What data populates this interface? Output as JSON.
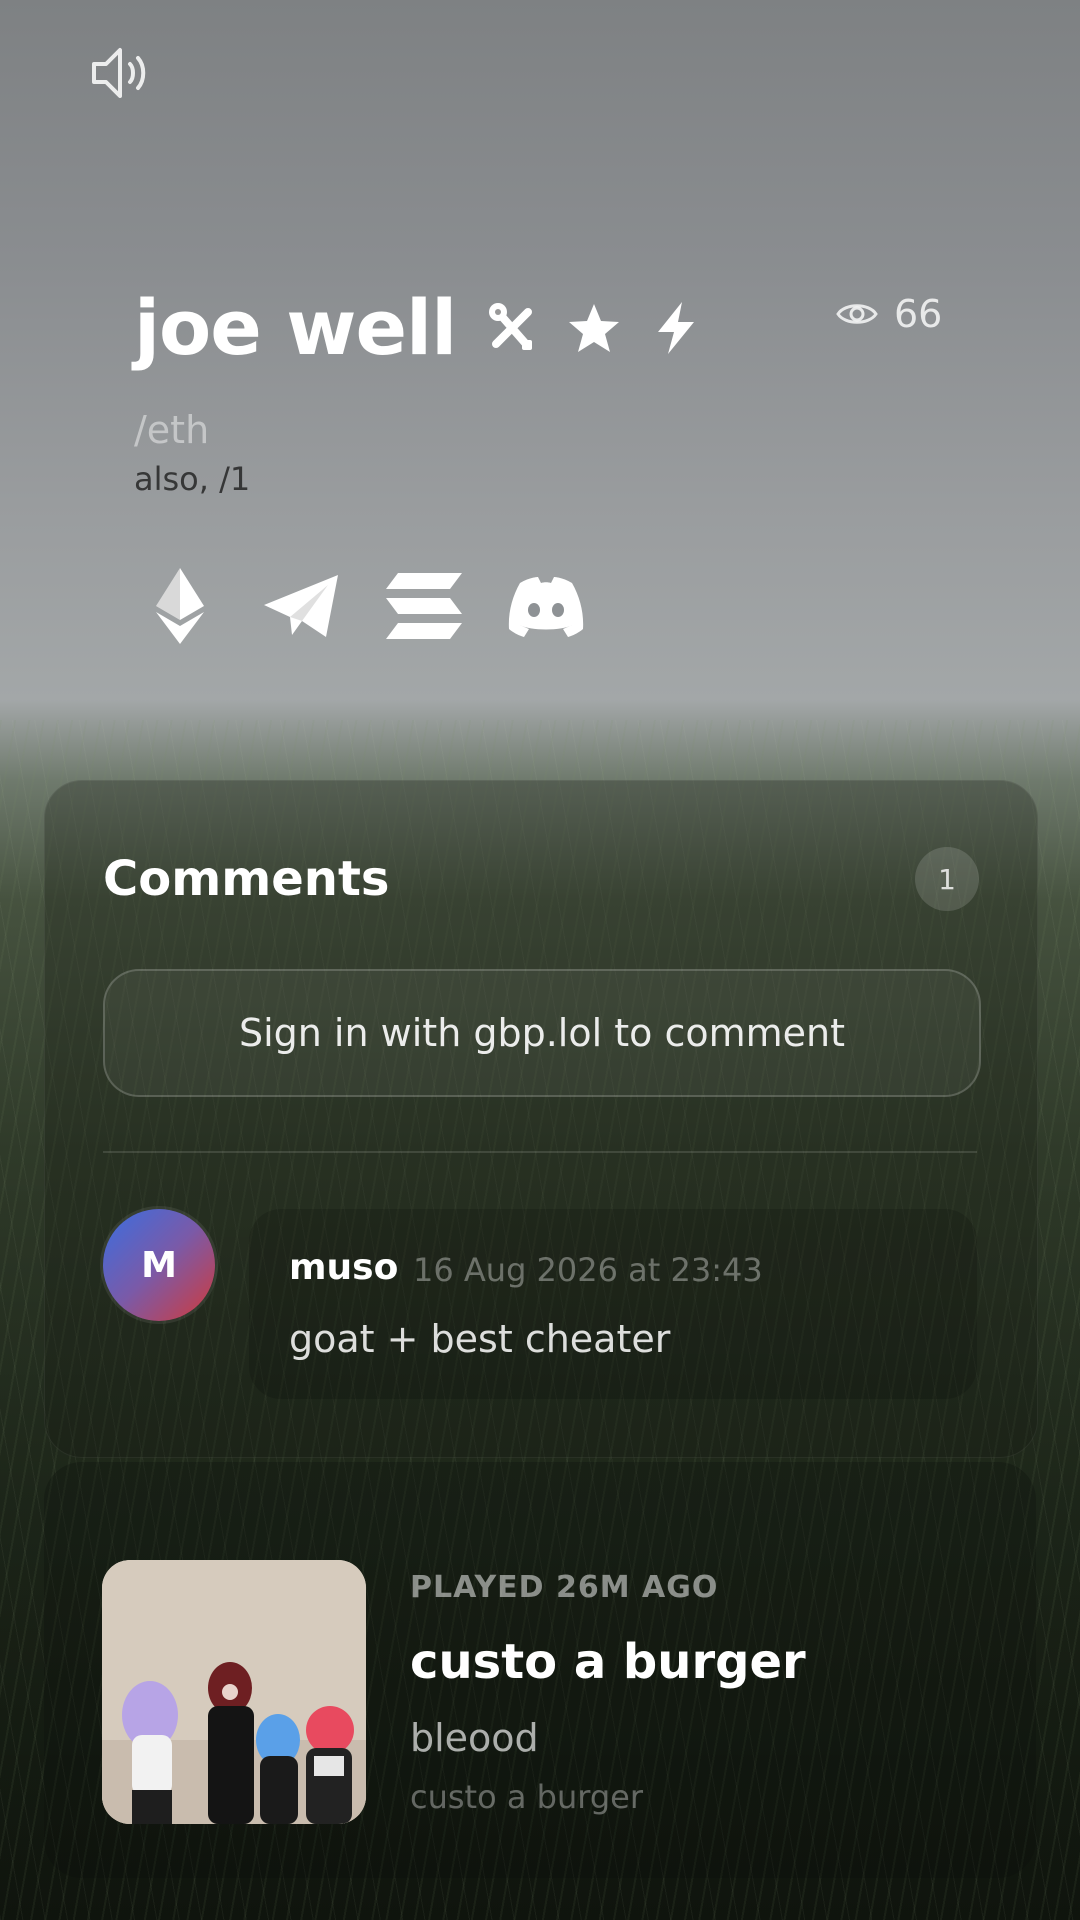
{
  "profile": {
    "name": "joe well",
    "handle": "/eth",
    "also": "also, /1",
    "views": "66"
  },
  "comments": {
    "title": "Comments",
    "count": "1",
    "signin_label": "Sign in with gbp.lol to comment",
    "items": [
      {
        "avatar_initial": "M",
        "author": "muso",
        "time": "16 Aug 2026 at 23:43",
        "text": "goat + best cheater"
      }
    ]
  },
  "music": {
    "played": "PLAYED 26M AGO",
    "track": "custo a burger",
    "artist": "bleood",
    "album": "custo a burger"
  },
  "icons": {
    "sound": "speaker-icon",
    "badges": [
      "tools-icon",
      "star-icon",
      "lightning-icon"
    ],
    "views": "eye-icon",
    "socials": [
      "ethereum-icon",
      "telegram-icon",
      "solana-icon",
      "discord-icon"
    ]
  }
}
